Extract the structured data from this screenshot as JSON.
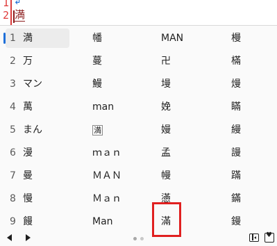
{
  "editor": {
    "line_numbers": [
      "1",
      "2"
    ],
    "eol_mark": "↲",
    "composition_text": "満"
  },
  "candidates": {
    "rows": [
      {
        "num": "1",
        "cells": [
          "満",
          "幡",
          "MAN",
          "槾"
        ]
      },
      {
        "num": "2",
        "cells": [
          "万",
          "蔓",
          "卍",
          "樠"
        ]
      },
      {
        "num": "3",
        "cells": [
          "マン",
          "鰻",
          "墁",
          "熳"
        ]
      },
      {
        "num": "4",
        "cells": [
          "萬",
          "man",
          "娩",
          "瞞"
        ]
      },
      {
        "num": "5",
        "cells": [
          "まん",
          "満",
          "嫚",
          "縵"
        ]
      },
      {
        "num": "6",
        "cells": [
          "漫",
          "ｍａｎ",
          "孟",
          "謾"
        ]
      },
      {
        "num": "7",
        "cells": [
          "曼",
          "ＭＡＮ",
          "幔",
          "蹣"
        ]
      },
      {
        "num": "8",
        "cells": [
          "慢",
          "Ｍａｎ",
          "懣",
          "鏋"
        ]
      },
      {
        "num": "9",
        "cells": [
          "饅",
          "Man",
          "滿",
          "鏝"
        ]
      }
    ],
    "selected_index": 0,
    "boxed_cell": {
      "row": 4,
      "col": 1
    }
  },
  "bottom_bar": {
    "prev_icon": "triangle-left-icon",
    "next_icon": "triangle-right-icon",
    "page_dots": 2,
    "panel_icon": "side-panel-icon",
    "favorite_icon": "heart-bookmark-icon",
    "favorite_glyph": "♥"
  },
  "colors": {
    "accent": "#1e6fd9",
    "line_number": "#e03a3a",
    "highlight_box": "#e02020"
  }
}
